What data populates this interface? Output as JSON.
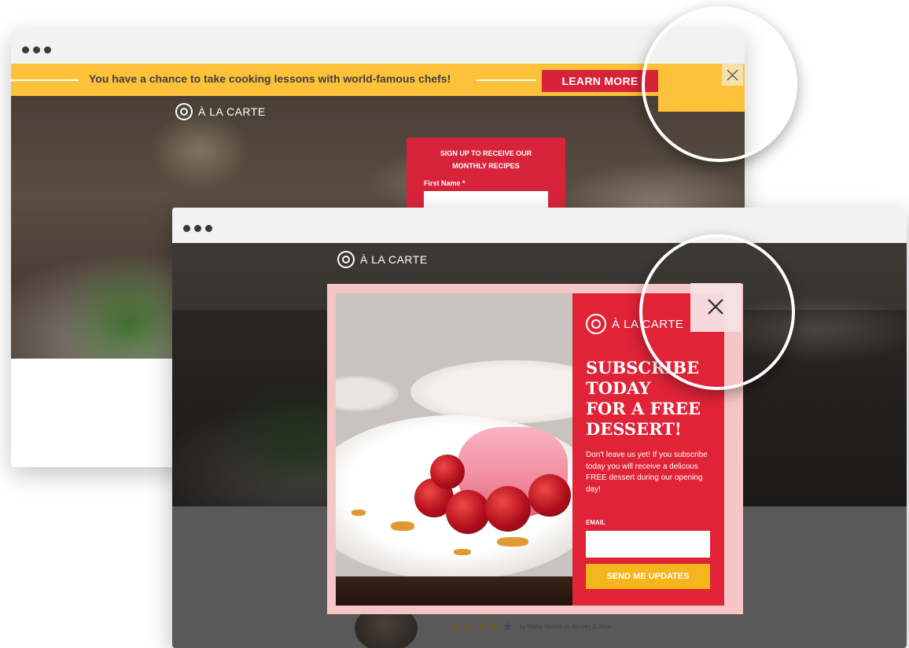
{
  "back_window": {
    "banner": {
      "text": "You have a chance to take cooking lessons with world-famous chefs!",
      "button_label": "LEARN MORE"
    },
    "logo_text": "À LA CARTE",
    "signup": {
      "title_line1": "SIGN UP TO RECEIVE OUR",
      "title_line2": "MONTHLY RECIPES",
      "first_name_label": "First Name *",
      "first_name_value": ""
    }
  },
  "front_window": {
    "logo_text": "À LA CARTE",
    "review_meta": "by Robby Nichols on January 2, 2014",
    "review_stars": 4,
    "popup": {
      "logo_text": "À LA CARTE",
      "headline": [
        "SUBSCRIBE",
        "TODAY",
        "FOR A FREE",
        "DESSERT!"
      ],
      "body": "Don't leave us yet! If you subscribe today you will receive a delicous FREE dessert during our opening day!",
      "email_label": "EMAIL",
      "email_value": "",
      "button_label": "SEND ME UPDATES"
    }
  },
  "colors": {
    "banner_yellow": "#fec23a",
    "brand_red": "#e02337",
    "button_yellow": "#f5b51c",
    "popup_frame_pink": "#f5c6c6"
  }
}
